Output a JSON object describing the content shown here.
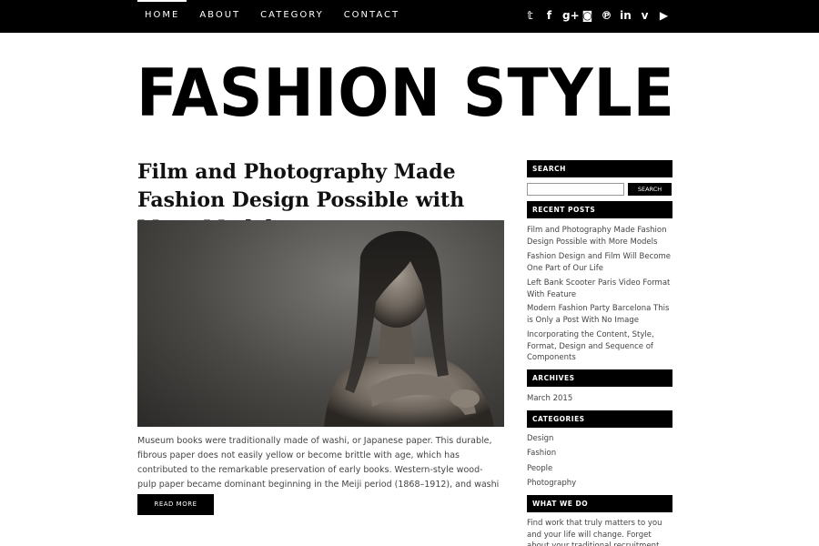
{
  "nav": {
    "items": [
      "HOME",
      "ABOUT",
      "CATEGORY",
      "CONTACT"
    ],
    "social_icons": [
      "twitter-icon",
      "facebook-icon",
      "google-plus-icon",
      "instagram-icon",
      "pinterest-icon",
      "linkedin-icon",
      "vimeo-icon",
      "youtube-icon"
    ],
    "social_glyphs": [
      "𝕥",
      "f",
      "g+",
      "◙",
      "℗",
      "in",
      "v",
      "▶"
    ]
  },
  "logo": {
    "text": "FASHION STYLE"
  },
  "post": {
    "title": "Film and Photography Made Fashion Design Possible with More Models",
    "excerpt": "Museum books were traditionally made of washi, or Japanese paper. This durable, fibrous paper does not easily yellow or become brittle with age, which has contributed to the remarkable preservation of early books. Western-style wood-pulp paper became dominant beginning in the Meiji period (1868–1912), and washi ...",
    "read_more": "READ MORE"
  },
  "sidebar": {
    "search": {
      "heading": "SEARCH",
      "button": "SEARCH",
      "placeholder": ""
    },
    "recent": {
      "heading": "RECENT POSTS",
      "items": [
        "Film and Photography Made Fashion Design Possible with More Models",
        "Fashion Design and Film Will Become One Part of Our Life",
        "Left Bank Scooter Paris Video Format With Feature",
        "Modern Fashion Party Barcelona This is Only a Post With No Image",
        "Incorporating the Content, Style, Format, Design and Sequence of Components"
      ]
    },
    "archives": {
      "heading": "ARCHIVES",
      "items": [
        "March 2015"
      ]
    },
    "categories": {
      "heading": "CATEGORIES",
      "items": [
        "Design",
        "Fashion",
        "People",
        "Photography"
      ]
    },
    "what_we_do": {
      "heading": "WHAT WE DO",
      "text": "Find work that truly matters to you and your life will change. Forget about your traditional recruitment and"
    }
  },
  "colors": {
    "bar": "#000000",
    "text": "#444444",
    "accent": "#ffffff"
  }
}
